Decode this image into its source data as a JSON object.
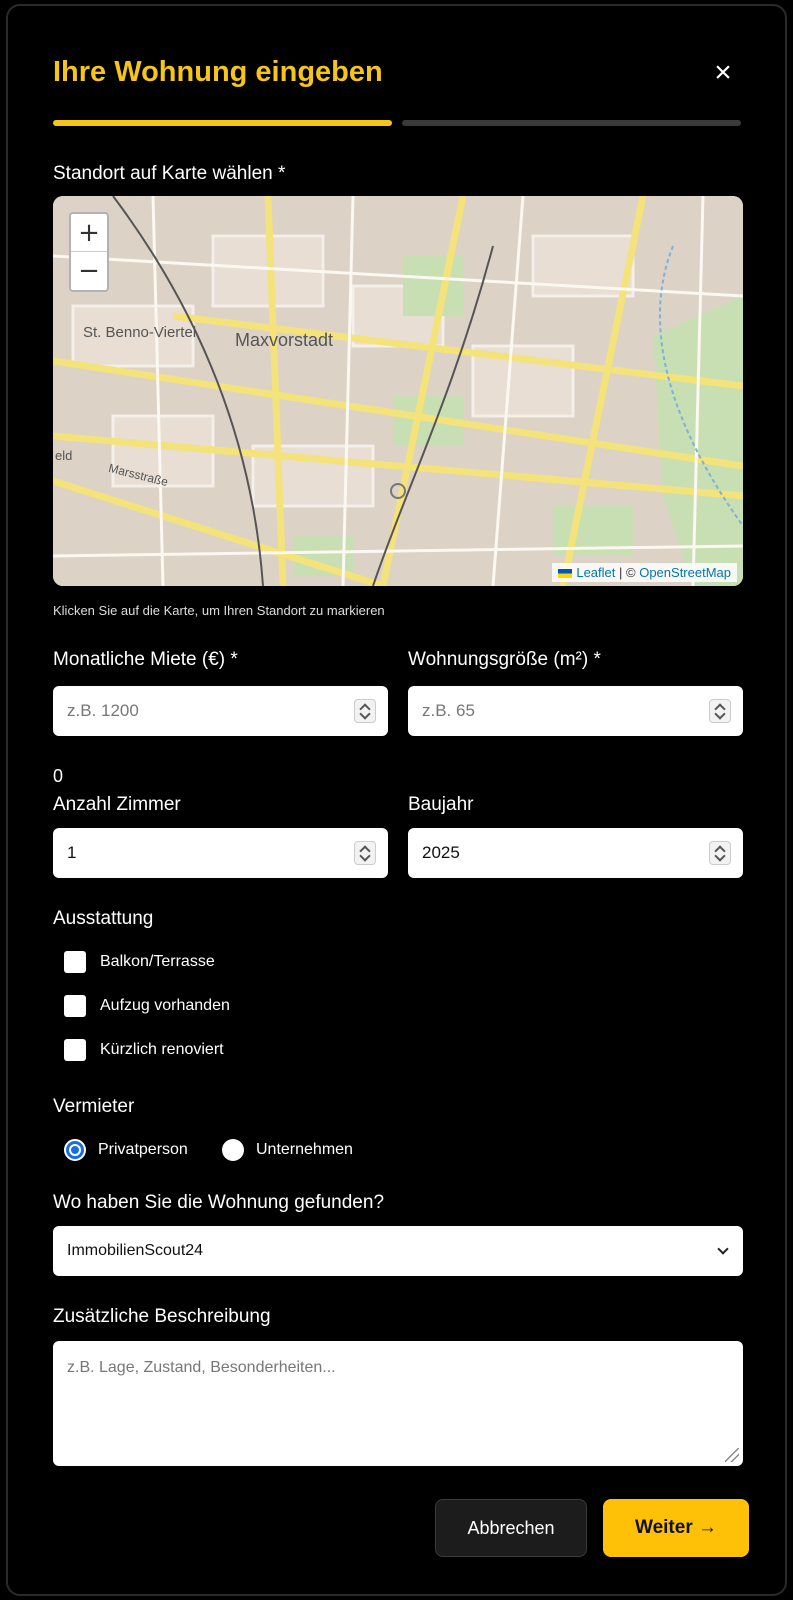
{
  "modal": {
    "title": "Ihre Wohnung eingeben",
    "close_icon": "×"
  },
  "map_section": {
    "label": "Standort auf Karte wählen *",
    "hint": "Klicken Sie auf die Karte, um Ihren Standort zu markieren",
    "zoom_in": "+",
    "zoom_out": "−",
    "place_labels": [
      "St. Benno-Viertel",
      "Maxvorstadt",
      "Marsstraße",
      "eld"
    ],
    "attribution_leaflet": "Leaflet",
    "attribution_sep": "| ©",
    "attribution_osm": "OpenStreetMap"
  },
  "fields": {
    "rent": {
      "label": "Monatliche Miete (€) *",
      "placeholder": "z.B. 1200"
    },
    "size": {
      "label": "Wohnungsgröße (m²) *",
      "placeholder": "z.B. 65"
    },
    "stray_value": "0",
    "rooms": {
      "label": "Anzahl Zimmer",
      "value": "1"
    },
    "year": {
      "label": "Baujahr",
      "value": "2025"
    }
  },
  "features": {
    "label": "Ausstattung",
    "items": [
      "Balkon/Terrasse",
      "Aufzug vorhanden",
      "Kürzlich renoviert"
    ]
  },
  "landlord": {
    "label": "Vermieter",
    "options": [
      "Privatperson",
      "Unternehmen"
    ],
    "selected": "Privatperson"
  },
  "source": {
    "label": "Wo haben Sie die Wohnung gefunden?",
    "value": "ImmobilienScout24"
  },
  "description": {
    "label": "Zusätzliche Beschreibung",
    "placeholder": "z.B. Lage, Zustand, Besonderheiten..."
  },
  "buttons": {
    "cancel": "Abbrechen",
    "next": "Weiter →"
  },
  "colors": {
    "accent": "#f5c518",
    "primary_button": "#ffc107",
    "radio_selected": "#1a6fe0"
  }
}
